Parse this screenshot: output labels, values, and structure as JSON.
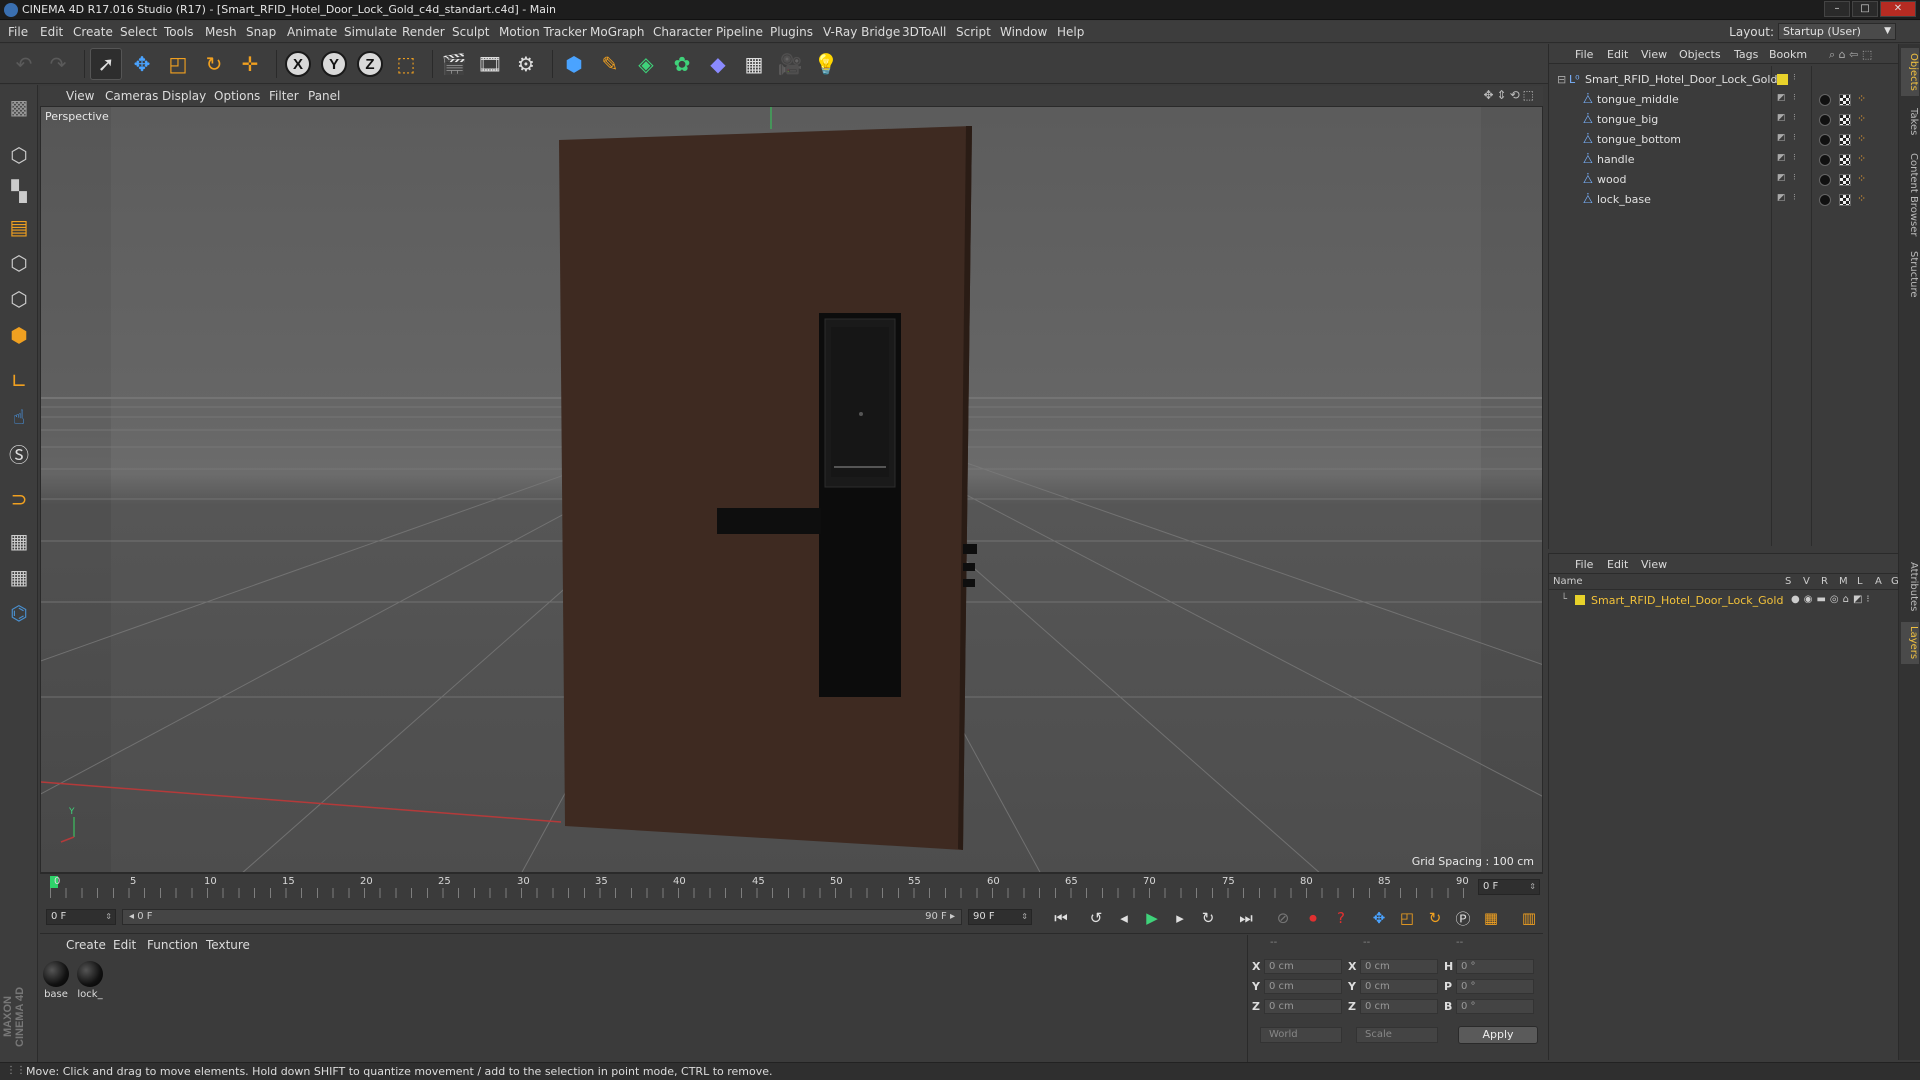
{
  "window": {
    "title": "CINEMA 4D R17.016 Studio (R17) - [Smart_RFID_Hotel_Door_Lock_Gold_c4d_standart.c4d] - Main",
    "buttons": [
      "–",
      "□",
      "✕"
    ]
  },
  "menu": {
    "items": [
      "File",
      "Edit",
      "Create",
      "Select",
      "Tools",
      "Mesh",
      "Snap",
      "Animate",
      "Simulate",
      "Render",
      "Sculpt",
      "Motion Tracker",
      "MoGraph",
      "Character",
      "Pipeline",
      "Plugins",
      "V-Ray Bridge",
      "3DToAll",
      "Script",
      "Window",
      "Help"
    ],
    "layout_label": "Layout:",
    "layout_value": "Startup (User)"
  },
  "viewport": {
    "menu": [
      "View",
      "Cameras",
      "Display",
      "Options",
      "Filter",
      "Panel"
    ],
    "camera_label": "Perspective",
    "grid_spacing": "Grid Spacing : 100 cm",
    "axis_y": "Y"
  },
  "timeline": {
    "ticks": [
      "0",
      "5",
      "10",
      "15",
      "20",
      "25",
      "30",
      "35",
      "40",
      "45",
      "50",
      "55",
      "60",
      "65",
      "70",
      "75",
      "80",
      "85",
      "90"
    ],
    "current_frame": "0 F",
    "start_frame": "0 F",
    "slider_left": "◂ 0 F",
    "slider_right": "90 F ▸",
    "end_frame": "90 F"
  },
  "materials": {
    "menu": [
      "Create",
      "Edit",
      "Function",
      "Texture"
    ],
    "items": [
      {
        "label": "base"
      },
      {
        "label": "lock_"
      }
    ]
  },
  "coords": {
    "head": [
      "--",
      "--",
      "--"
    ],
    "rows": [
      {
        "a": "X",
        "v1": "0 cm",
        "b": "X",
        "v2": "0 cm",
        "c": "H",
        "v3": "0 °"
      },
      {
        "a": "Y",
        "v1": "0 cm",
        "b": "Y",
        "v2": "0 cm",
        "c": "P",
        "v3": "0 °"
      },
      {
        "a": "Z",
        "v1": "0 cm",
        "b": "Z",
        "v2": "0 cm",
        "c": "B",
        "v3": "0 °"
      }
    ],
    "world": "World",
    "scale": "Scale",
    "apply": "Apply"
  },
  "objects": {
    "menu": [
      "File",
      "Edit",
      "View",
      "Objects",
      "Tags",
      "Bookm"
    ],
    "root": "Smart_RFID_Hotel_Door_Lock_Gold",
    "children": [
      "tongue_middle",
      "tongue_big",
      "tongue_bottom",
      "handle",
      "wood",
      "lock_base"
    ]
  },
  "layers": {
    "menu": [
      "File",
      "Edit",
      "View"
    ],
    "columns": [
      "Name",
      "S",
      "V",
      "R",
      "M",
      "L",
      "A",
      "G"
    ],
    "rows": [
      {
        "name": "Smart_RFID_Hotel_Door_Lock_Gold",
        "color": "#e8d22a"
      }
    ]
  },
  "side_tabs": {
    "top": [
      "Objects",
      "Takes",
      "Content Browser",
      "Structure"
    ],
    "bottom": [
      "Attributes",
      "Layers"
    ]
  },
  "status": "Move: Click and drag to move elements. Hold down SHIFT to quantize movement / add to the selection in point mode, CTRL to remove.",
  "brand": "MAXON CINEMA 4D"
}
